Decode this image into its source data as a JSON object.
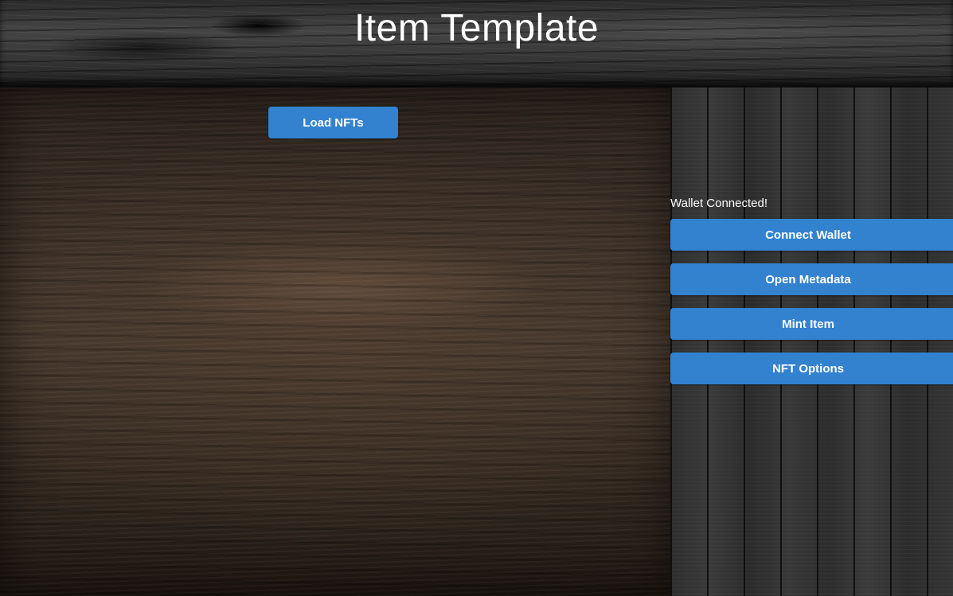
{
  "header": {
    "title": "Item Template"
  },
  "main": {
    "load_nfts_label": "Load NFTs"
  },
  "sidebar": {
    "status_text": "Wallet Connected!",
    "buttons": [
      {
        "label": "Connect Wallet"
      },
      {
        "label": "Open Metadata"
      },
      {
        "label": "Mint Item"
      },
      {
        "label": "NFT Options"
      }
    ]
  },
  "colors": {
    "button_bg": "#3282d0",
    "button_text": "#ffffff",
    "title_text": "#ffffff"
  }
}
